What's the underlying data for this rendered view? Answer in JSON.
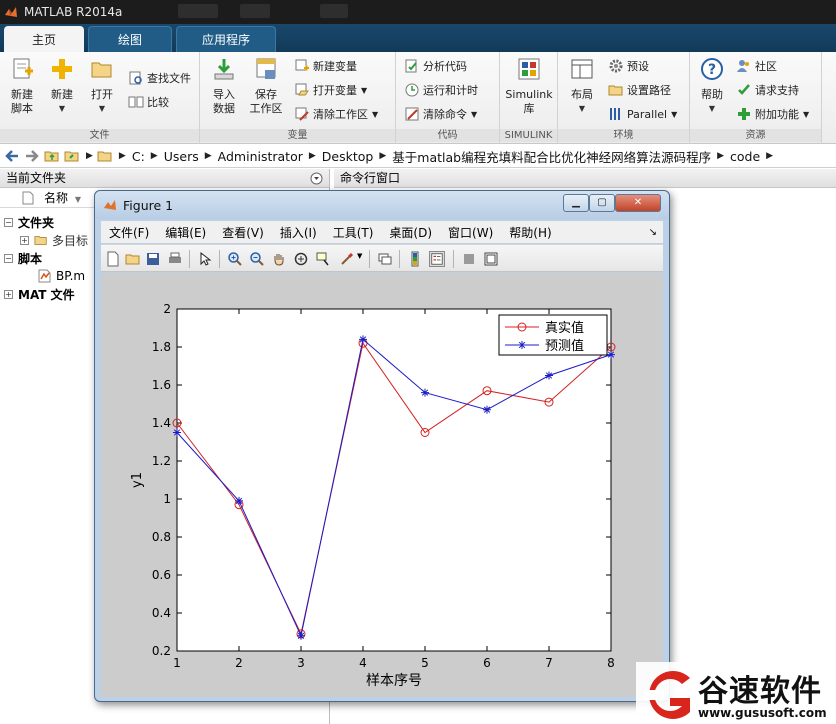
{
  "app": {
    "title": "MATLAB R2014a"
  },
  "tabs": [
    {
      "label": "主页",
      "active": true
    },
    {
      "label": "绘图",
      "active": false
    },
    {
      "label": "应用程序",
      "active": false
    }
  ],
  "ribbon": {
    "file_group": {
      "label": "文件",
      "new_script": [
        "新建",
        "脚本"
      ],
      "new": "新建",
      "open": "打开",
      "find_files": "查找文件",
      "compare": "比较"
    },
    "variable_group": {
      "label": "变量",
      "import": [
        "导入",
        "数据"
      ],
      "save_workspace": [
        "保存",
        "工作区"
      ],
      "new_variable": "新建变量",
      "open_variable": "打开变量",
      "clear_workspace": "清除工作区"
    },
    "code_group": {
      "label": "代码",
      "analyze": "分析代码",
      "run_time": "运行和计时",
      "clear_commands": "清除命令"
    },
    "simulink_group": {
      "label": "SIMULINK",
      "simulink": [
        "Simulink",
        "库"
      ]
    },
    "environment_group": {
      "label": "环境",
      "layout": "布局",
      "preferences": "预设",
      "set_path": "设置路径",
      "parallel": "Parallel"
    },
    "resources_group": {
      "label": "资源",
      "help": "帮助",
      "community": "社区",
      "request_support": "请求支持",
      "addons": "附加功能"
    }
  },
  "address": {
    "crumbs": [
      "C:",
      "Users",
      "Administrator",
      "Desktop",
      "基于matlab编程充填料配合比优化神经网络算法源码程序",
      "code"
    ]
  },
  "current_folder": {
    "title": "当前文件夹",
    "column_name": "名称",
    "folders_label": "文件夹",
    "folder_item": "多目标",
    "scripts_label": "脚本",
    "script_item": "BP.m",
    "mat_label": "MAT 文件"
  },
  "command_window": {
    "title": "命令行窗口"
  },
  "figure": {
    "title": "Figure 1",
    "menus": [
      "文件(F)",
      "编辑(E)",
      "查看(V)",
      "插入(I)",
      "工具(T)",
      "桌面(D)",
      "窗口(W)",
      "帮助(H)"
    ]
  },
  "chart_data": {
    "type": "line",
    "x": [
      1,
      2,
      3,
      4,
      5,
      6,
      7,
      8
    ],
    "series": [
      {
        "name": "真实值",
        "values": [
          1.4,
          0.97,
          0.29,
          1.82,
          1.35,
          1.57,
          1.51,
          1.8
        ],
        "color": "#d42020",
        "marker": "circle"
      },
      {
        "name": "预测值",
        "values": [
          1.35,
          0.99,
          0.28,
          1.84,
          1.56,
          1.47,
          1.65,
          1.76
        ],
        "color": "#1c1cc8",
        "marker": "star"
      }
    ],
    "xlabel": "样本序号",
    "ylabel": "y1",
    "xlim": [
      1,
      8
    ],
    "ylim": [
      0.2,
      2
    ],
    "xticks": [
      1,
      2,
      3,
      4,
      5,
      6,
      7,
      8
    ],
    "yticks": [
      0.2,
      0.4,
      0.6,
      0.8,
      1,
      1.2,
      1.4,
      1.6,
      1.8,
      2
    ],
    "grid": false,
    "legend_position": "top-right"
  },
  "watermark": {
    "brand": "谷速软件",
    "url": "www.gususoft.com"
  }
}
